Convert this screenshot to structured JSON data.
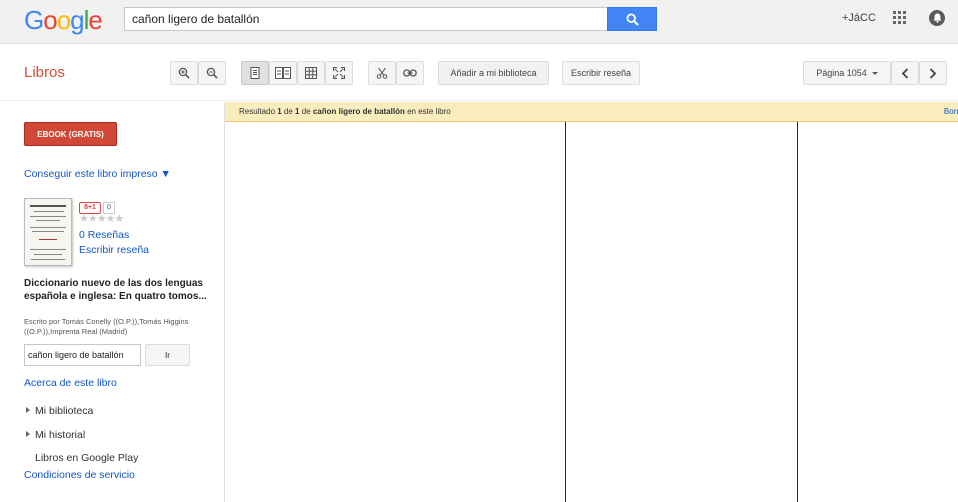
{
  "header": {
    "logo": [
      "G",
      "o",
      "o",
      "g",
      "l",
      "e"
    ],
    "logo_colors": [
      "#4285f4",
      "#ea4335",
      "#fbbc05",
      "#4285f4",
      "#34a853",
      "#ea4335"
    ],
    "search_value": "cañon ligero de batallón",
    "user": "+JáCC"
  },
  "toolbar": {
    "section": "Libros",
    "add_library": "Añadir a mi biblioteca",
    "write_review": "Escribir reseña",
    "page_label": "Página 1054"
  },
  "sidebar": {
    "ebook_button": "EBOOK (GRATIS)",
    "print_link": "Conseguir este libro impreso ▼",
    "gplus": "8+1",
    "gplus_count": "0",
    "stars": "★★★★★",
    "reviews": "0 Reseñas",
    "write_review": "Escribir reseña",
    "book_title": "Diccionario nuevo de las dos lenguas española e inglesa: En quatro tomos...",
    "book_authors": "Escrito por Tomás Conelly ((O.P.)),Tomás Higgins ((O.P.)),Imprenta Real (Madrid)",
    "inbook_search": "cañon ligero de batallón",
    "ir_button": "Ir",
    "about_link": "Acerca de este libro",
    "nav": [
      "Mi biblioteca",
      "Mi historial"
    ],
    "play_link": "Libros en Google Play",
    "terms_link": "Condiciones de servicio"
  },
  "result_bar": {
    "prefix": "Resultado ",
    "n": "1",
    "of": " de ",
    "total": "1",
    "de": " de ",
    "query": "cañon ligero de batallón",
    "suffix": " en este libro",
    "right_link": "Borr"
  }
}
